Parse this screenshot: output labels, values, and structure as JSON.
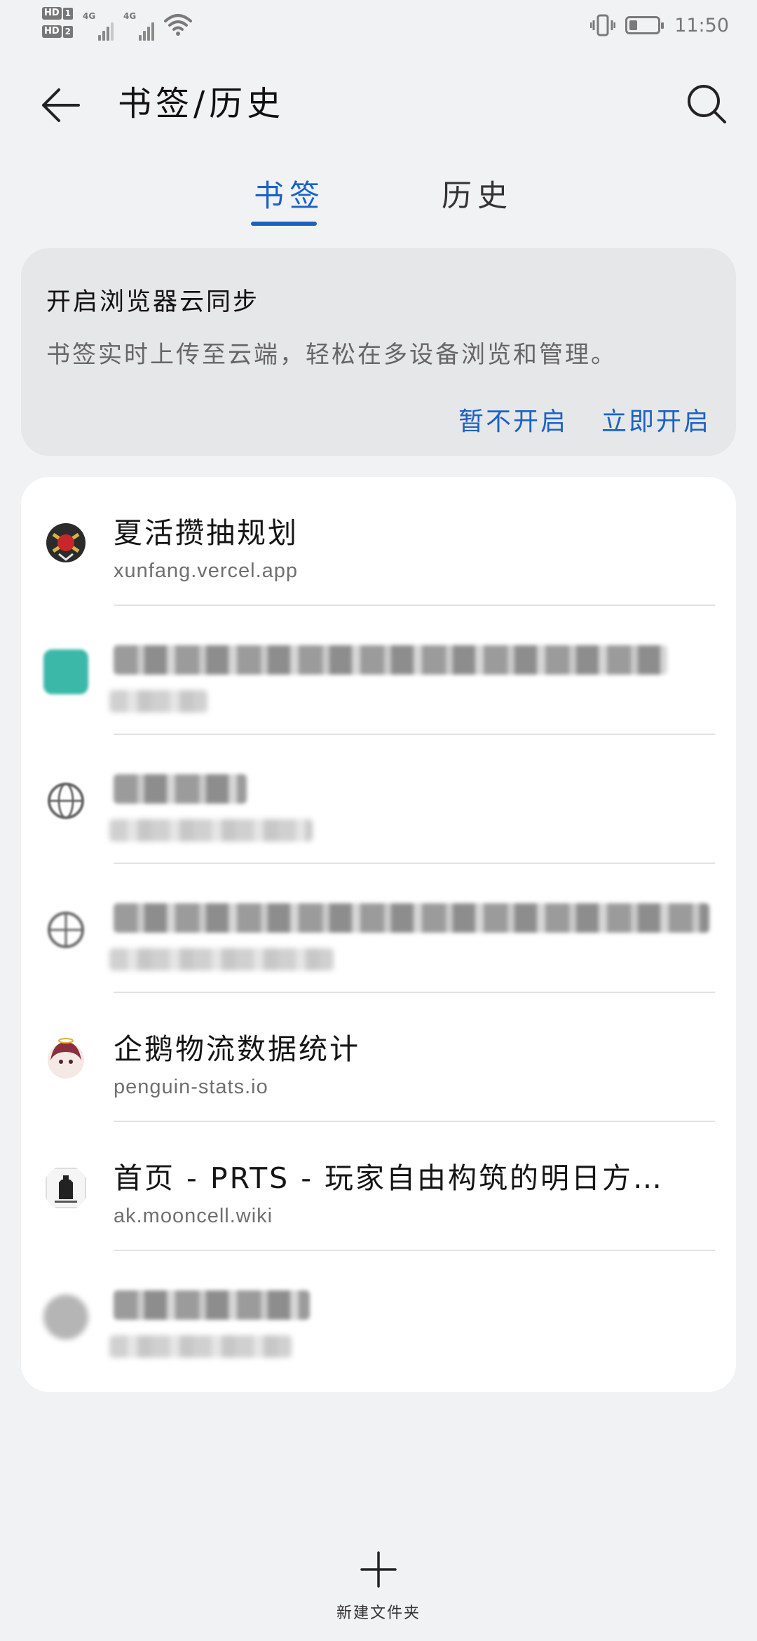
{
  "status_bar": {
    "sim1": "HD",
    "sim1_num": "1",
    "sim2": "HD",
    "sim2_num": "2",
    "net1": "4G",
    "net2": "4G",
    "time": "11:50",
    "icons": [
      "vibrate-icon",
      "battery-icon",
      "wifi-icon",
      "signal-icon"
    ]
  },
  "appbar": {
    "title": "书签/历史",
    "back_icon": "arrow-left-icon",
    "search_icon": "search-icon"
  },
  "tabs": [
    {
      "label": "书签",
      "active": true
    },
    {
      "label": "历史",
      "active": false
    }
  ],
  "sync_card": {
    "title": "开启浏览器云同步",
    "description": "书签实时上传至云端，轻松在多设备浏览和管理。",
    "dismiss_label": "暂不开启",
    "enable_label": "立即开启"
  },
  "bookmarks": [
    {
      "title": "夏活攒抽规划",
      "url": "xunfang.vercel.app"
    },
    {
      "title": "",
      "url": ""
    },
    {
      "title": "",
      "url": ""
    },
    {
      "title": "",
      "url": ""
    },
    {
      "title": "企鹅物流数据统计",
      "url": "penguin-stats.io"
    },
    {
      "title": "首页 - PRTS - 玩家自由构筑的明日方…",
      "url": "ak.mooncell.wiki"
    },
    {
      "title": "",
      "url": ""
    }
  ],
  "footer": {
    "new_folder_label": "新建文件夹",
    "new_folder_icon": "plus-icon"
  },
  "colors": {
    "accent": "#1a63c4",
    "background": "#f1f2f4",
    "card": "#ffffff",
    "sync_card": "#e6e7e9"
  }
}
